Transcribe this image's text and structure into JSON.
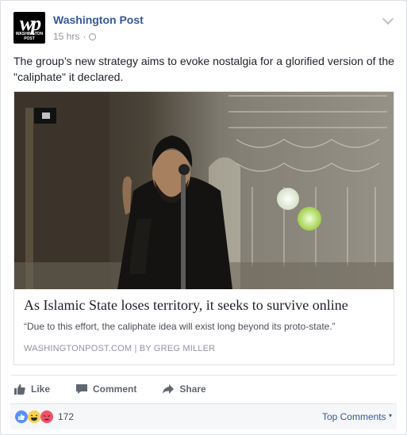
{
  "post": {
    "page_name": "Washington Post",
    "timestamp": "15 hrs",
    "separator": "·",
    "logo_text": "wp",
    "logo_subtext": "WASHINGTON POST",
    "text": "The group’s new strategy aims to evoke nostalgia for a glorified version of the \"caliphate\" it declared."
  },
  "link": {
    "title": "As Islamic State loses territory, it seeks to survive online",
    "description": "“Due to this effort, the caliphate idea will exist long beyond its proto-state.”",
    "source": "WASHINGTONPOST.COM | BY GREG MILLER"
  },
  "actions": {
    "like": "Like",
    "comment": "Comment",
    "share": "Share"
  },
  "reactions": {
    "count": "172",
    "types": [
      "like-icon",
      "haha-icon",
      "angry-icon"
    ],
    "top_comments": "Top Comments"
  },
  "colors": {
    "link_blue": "#365899",
    "meta_gray": "#90949c",
    "like_blue": "#5890ff",
    "angry_red": "#f25268",
    "haha_yellow": "#fbd14b"
  }
}
